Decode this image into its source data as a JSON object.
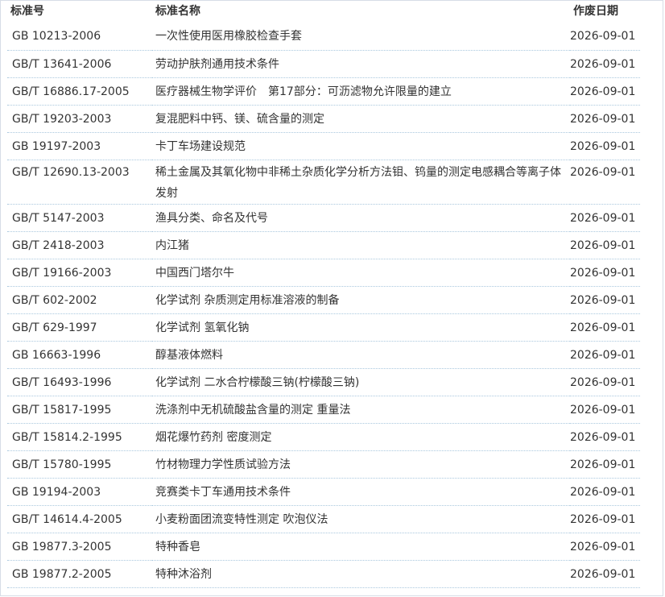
{
  "table": {
    "headers": {
      "code": "标准号",
      "name": "标准名称",
      "date": "作废日期"
    },
    "rows": [
      {
        "code": "GB 10213-2006",
        "name": "一次性使用医用橡胶检查手套",
        "date": "2026-09-01"
      },
      {
        "code": "GB/T 13641-2006",
        "name": "劳动护肤剂通用技术条件",
        "date": "2026-09-01"
      },
      {
        "code": "GB/T 16886.17-2005",
        "name": "医疗器械生物学评价　第17部分：可沥滤物允许限量的建立",
        "date": "2026-09-01"
      },
      {
        "code": "GB/T 19203-2003",
        "name": "复混肥料中钙、镁、硫含量的测定",
        "date": "2026-09-01"
      },
      {
        "code": "GB 19197-2003",
        "name": "卡丁车场建设规范",
        "date": "2026-09-01"
      },
      {
        "code": "GB/T 12690.13-2003",
        "name": "稀土金属及其氧化物中非稀土杂质化学分析方法钼、钨量的测定电感耦合等离子体发射",
        "date": "2026-09-01"
      },
      {
        "code": "GB/T 5147-2003",
        "name": "渔具分类、命名及代号",
        "date": "2026-09-01"
      },
      {
        "code": "GB/T 2418-2003",
        "name": "内江猪",
        "date": "2026-09-01"
      },
      {
        "code": "GB/T 19166-2003",
        "name": "中国西门塔尔牛",
        "date": "2026-09-01"
      },
      {
        "code": "GB/T 602-2002",
        "name": "化学试剂 杂质测定用标准溶液的制备",
        "date": "2026-09-01"
      },
      {
        "code": "GB/T 629-1997",
        "name": "化学试剂 氢氧化钠",
        "date": "2026-09-01"
      },
      {
        "code": "GB 16663-1996",
        "name": "醇基液体燃料",
        "date": "2026-09-01"
      },
      {
        "code": "GB/T 16493-1996",
        "name": "化学试剂 二水合柠檬酸三钠(柠檬酸三钠)",
        "date": "2026-09-01"
      },
      {
        "code": "GB/T 15817-1995",
        "name": "洗涤剂中无机硫酸盐含量的测定 重量法",
        "date": "2026-09-01"
      },
      {
        "code": "GB/T 15814.2-1995",
        "name": "烟花爆竹药剂 密度测定",
        "date": "2026-09-01"
      },
      {
        "code": "GB/T 15780-1995",
        "name": "竹材物理力学性质试验方法",
        "date": "2026-09-01"
      },
      {
        "code": "GB 19194-2003",
        "name": "竞赛类卡丁车通用技术条件",
        "date": "2026-09-01"
      },
      {
        "code": "GB/T 14614.4-2005",
        "name": "小麦粉面团流变特性测定 吹泡仪法",
        "date": "2026-09-01"
      },
      {
        "code": "GB 19877.3-2005",
        "name": "特种香皂",
        "date": "2026-09-01"
      },
      {
        "code": "GB 19877.2-2005",
        "name": "特种沐浴剂",
        "date": "2026-09-01"
      }
    ]
  }
}
